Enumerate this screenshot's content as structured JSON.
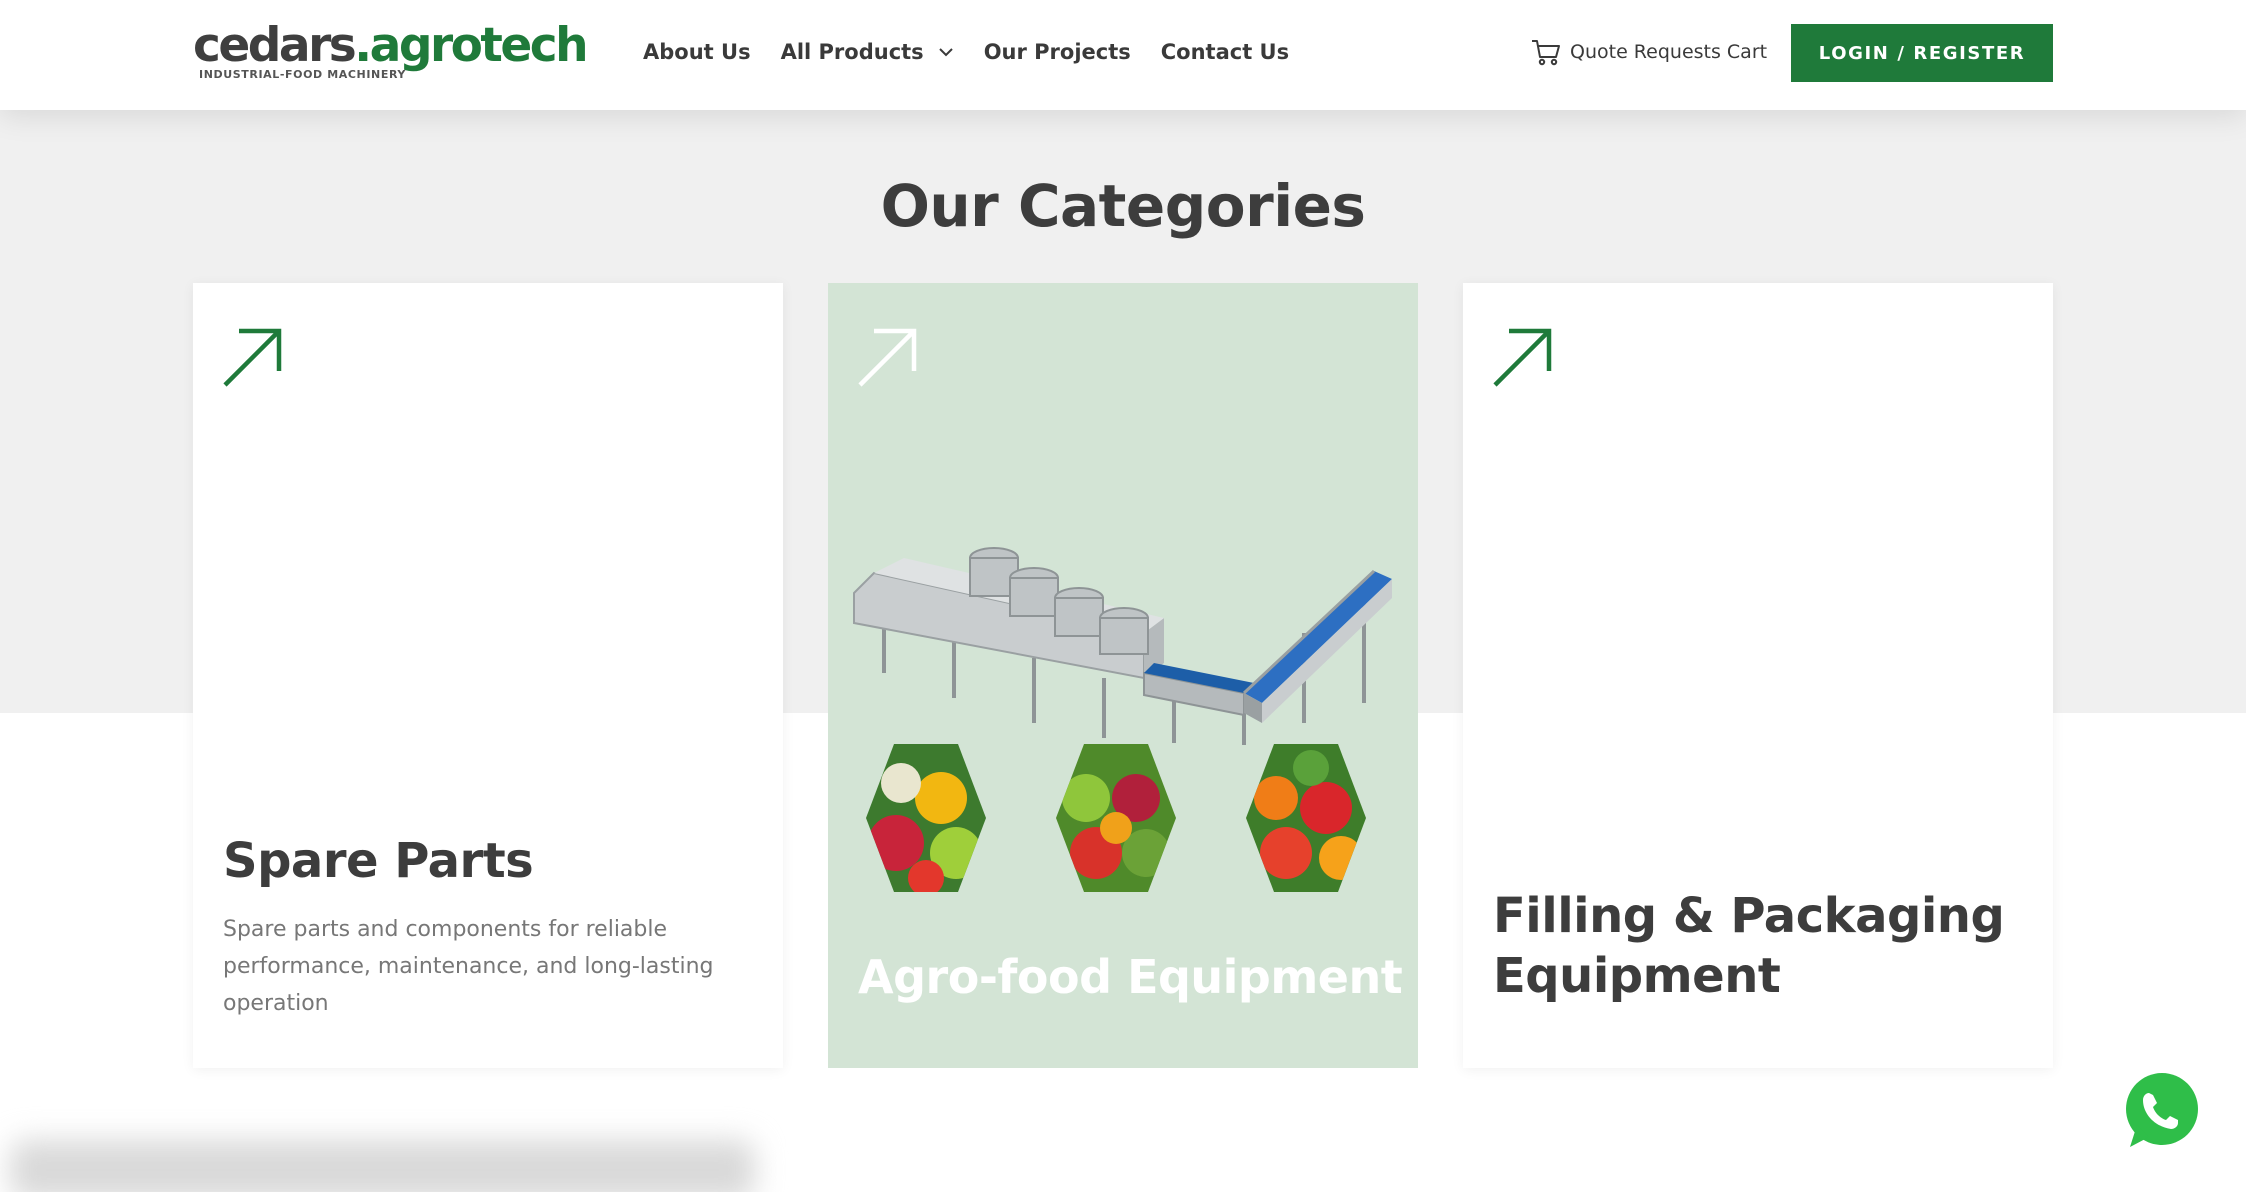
{
  "brand": {
    "logo_part1": "cedars",
    "logo_dot": ".",
    "logo_part2": "agrotech",
    "tagline": "INDUSTRIAL-FOOD MACHINERY"
  },
  "nav": {
    "items": [
      {
        "label": "About Us"
      },
      {
        "label": "All Products",
        "has_dropdown": true
      },
      {
        "label": "Our Projects"
      },
      {
        "label": "Contact Us"
      }
    ]
  },
  "cart": {
    "label": "Quote Requests Cart",
    "icon": "cart-icon"
  },
  "login": {
    "label": "LOGIN / REGISTER"
  },
  "categories": {
    "title": "Our Categories",
    "items": [
      {
        "title": "Spare Parts",
        "description": "Spare parts and components for reliable performance, maintenance, and long-lasting operation",
        "icon": "arrow-up-right-icon"
      },
      {
        "title": "Agro-food Equipment",
        "icon": "arrow-up-right-icon"
      },
      {
        "title": "Filling & Packaging Equipment",
        "icon": "arrow-up-right-icon"
      }
    ]
  },
  "colors": {
    "brand_green": "#1f7a3a",
    "highlight_card": "#d3e4d5",
    "section_bg": "#f0f0f0",
    "text_dark": "#3d3d3d"
  },
  "floating": {
    "icon": "whatsapp-icon"
  }
}
